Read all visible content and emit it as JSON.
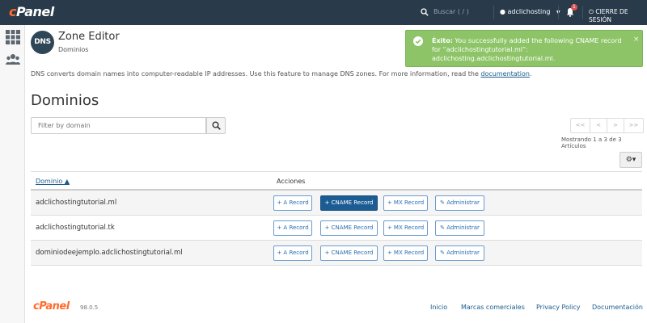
{
  "topbar": {
    "logo": "cPanel",
    "search_placeholder": "Buscar ( / )",
    "user": "adclichosting",
    "notifications_count": "1",
    "logout": "CIERRE DE SESIÓN"
  },
  "header": {
    "icon_text": "DNS",
    "title": "Zone Editor",
    "subtitle": "Dominios"
  },
  "alert": {
    "label": "Éxito:",
    "message": " You successfully added the following CNAME record for “adclichostingtutorial.ml”: adclichosting.adclichostingtutorial.ml.",
    "close": "×"
  },
  "intro": {
    "text": "DNS converts domain names into computer-readable IP addresses. Use this feature to manage DNS zones. For more information, read the ",
    "link": "documentation",
    "end": "."
  },
  "page_title": "Dominios",
  "filter": {
    "placeholder": "Filter by domain"
  },
  "pager": {
    "first": "<<",
    "prev": "<",
    "next": ">",
    "last": ">>"
  },
  "showing": "Mostrando 1 a 3 de 3 Artículos",
  "gear": "⚙▾",
  "table": {
    "col_domain": "Dominio ▲",
    "col_actions": "Acciones",
    "rows": [
      {
        "domain": "adclichostingtutorial.ml"
      },
      {
        "domain": "adclichostingtutorial.tk"
      },
      {
        "domain": "dominiodeejemplo.adclichostingtutorial.ml"
      }
    ],
    "btn_a": "+ A Record",
    "btn_cname": "+ CNAME Record",
    "btn_mx": "+ MX Record",
    "btn_admin": "✎ Administrar"
  },
  "footer": {
    "logo": "cPanel",
    "version": "98.0.5",
    "links": [
      "Inicio",
      "Marcas comerciales",
      "Privacy Policy",
      "Documentación"
    ]
  },
  "colors": {
    "topbar": "#293a4a",
    "brand_orange": "#ff6c2c",
    "alert_green": "#8dc467",
    "primary_button": "#1c5c94",
    "link": "#1a5b8c"
  }
}
